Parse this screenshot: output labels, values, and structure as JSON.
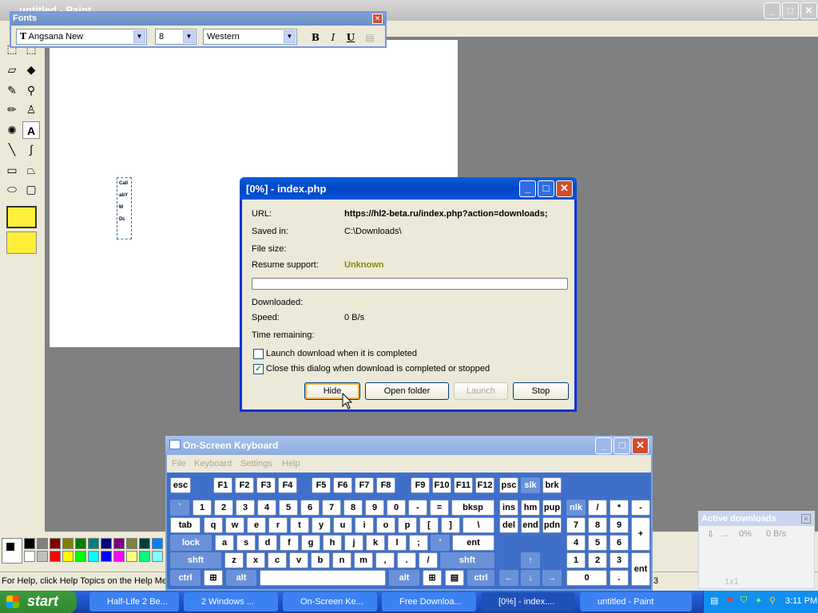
{
  "paint": {
    "title": "untitled - Paint",
    "status_text": "For Help, click Help Topics on the Help Menu.",
    "canvas_text": [
      "Call",
      "abY",
      "M",
      "Dc"
    ]
  },
  "fonts_toolbar": {
    "title": "Fonts",
    "font_name": "Angsana New",
    "font_size": "8",
    "script": "Western",
    "bold": "B",
    "italic": "I",
    "underline": "U"
  },
  "download_dialog": {
    "title": "[0%] - index.php",
    "url_label": "URL:",
    "url_value": "https://hl2-beta.ru/index.php?action=downloads;",
    "saved_label": "Saved in:",
    "saved_value": "C:\\Downloads\\",
    "size_label": "File size:",
    "resume_label": "Resume support:",
    "resume_value": "Unknown",
    "progress": 0,
    "downloaded_label": "Downloaded:",
    "speed_label": "Speed:",
    "speed_value": "0 B/s",
    "remaining_label": "Time remaining:",
    "launch_check_label": "Launch download when it is completed",
    "launch_checked": false,
    "close_check_label": "Close this dialog when download is completed or stopped",
    "close_checked": true,
    "hide_label": "Hide",
    "open_folder_label": "Open folder",
    "launch_label": "Launch",
    "stop_label": "Stop"
  },
  "osk": {
    "title": "On-Screen Keyboard",
    "menu": [
      "File",
      "Keyboard",
      "Settings",
      "Help"
    ],
    "keys": {
      "esc": "esc",
      "f1": "F1",
      "f2": "F2",
      "f3": "F3",
      "f4": "F4",
      "f5": "F5",
      "f6": "F6",
      "f7": "F7",
      "f8": "F8",
      "f9": "F9",
      "f10": "F10",
      "f11": "F11",
      "f12": "F12",
      "psc": "psc",
      "slk": "slk",
      "brk": "brk",
      "grave": "`",
      "n1": "1",
      "n2": "2",
      "n3": "3",
      "n4": "4",
      "n5": "5",
      "n6": "6",
      "n7": "7",
      "n8": "8",
      "n9": "9",
      "n0": "0",
      "minus": "-",
      "equal": "=",
      "bksp": "bksp",
      "ins": "ins",
      "hm": "hm",
      "pup": "pup",
      "nlk": "nlk",
      "kslash": "/",
      "kstar": "*",
      "kminus": "-",
      "tab": "tab",
      "q": "q",
      "w": "w",
      "e": "e",
      "r": "r",
      "t": "t",
      "y": "y",
      "u": "u",
      "i": "i",
      "o": "o",
      "p": "p",
      "lbr": "[",
      "rbr": "]",
      "bslash": "\\",
      "del": "del",
      "end": "end",
      "pdn": "pdn",
      "k7": "7",
      "k8": "8",
      "k9": "9",
      "kplus": "+",
      "lock": "lock",
      "a": "a",
      "s": "s",
      "d": "d",
      "f": "f",
      "g": "g",
      "h": "h",
      "j": "j",
      "k": "k",
      "l": "l",
      "semi": ";",
      "quote": "'",
      "ent": "ent",
      "k4": "4",
      "k5": "5",
      "k6": "6",
      "shft": "shft",
      "z": "z",
      "x": "x",
      "c": "c",
      "v": "v",
      "b": "b",
      "n": "n",
      "m": "m",
      "comma": ",",
      "dot": ".",
      "slash": "/",
      "rshft": "shft",
      "k1": "1",
      "k2": "2",
      "k3": "3",
      "kent": "ent",
      "ctrl": "ctrl",
      "alt": "alt",
      "ralt": "alt",
      "rctrl": "ctrl",
      "k0": "0",
      "kdot": "."
    }
  },
  "active_downloads": {
    "title": "Active downloads",
    "item_name": "...",
    "item_percent": "0%",
    "item_speed": "0 B/s",
    "footer": "1x1"
  },
  "taskbar": {
    "start_label": "start",
    "items": [
      "Half-Life 2 Be...",
      "2 Windows ...",
      "On-Screen Ke...",
      "Free Downloa...",
      "[0%] - index....",
      "untitled - Paint"
    ],
    "clock": "3:11 PM"
  }
}
